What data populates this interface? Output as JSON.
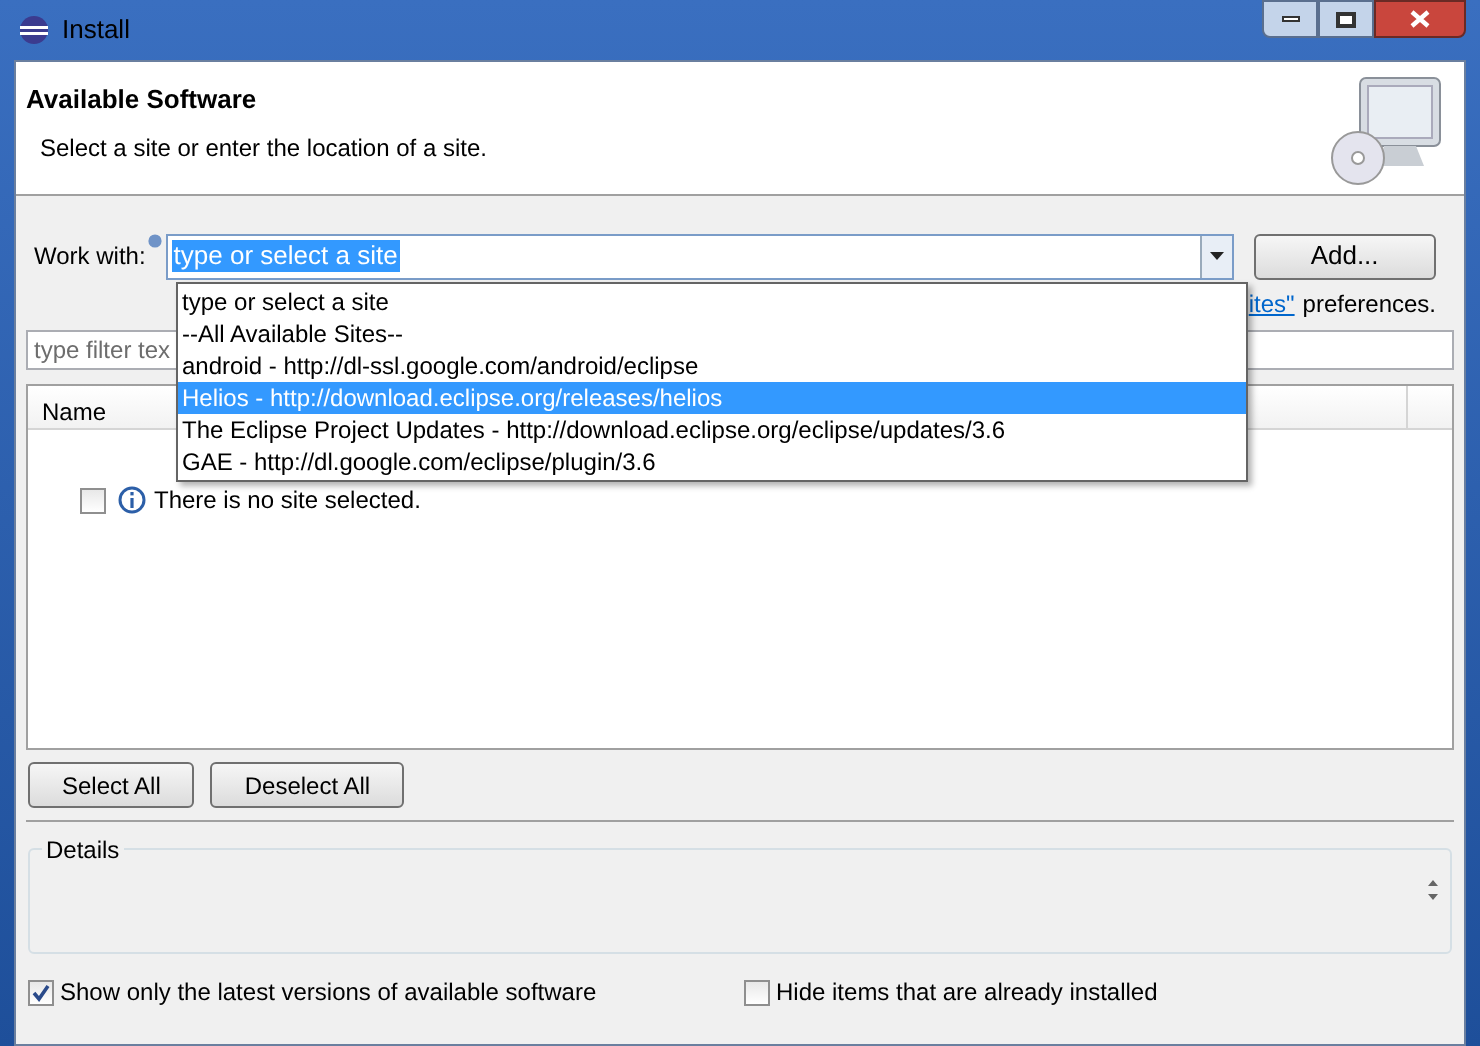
{
  "window": {
    "title": "Install"
  },
  "header": {
    "title": "Available Software",
    "subtitle": "Select a site or enter the location of a site."
  },
  "work_with": {
    "label": "Work with:",
    "value": "type or select a site",
    "button": "Add..."
  },
  "dropdown": [
    {
      "label": "type or select a site",
      "selected": false
    },
    {
      "label": "--All Available Sites--",
      "selected": false
    },
    {
      "label": "android - http://dl-ssl.google.com/android/eclipse",
      "selected": false
    },
    {
      "label": "Helios - http://download.eclipse.org/releases/helios",
      "selected": true
    },
    {
      "label": "The Eclipse Project Updates - http://download.eclipse.org/eclipse/updates/3.6",
      "selected": false
    },
    {
      "label": "GAE - http://dl.google.com/eclipse/plugin/3.6",
      "selected": false
    }
  ],
  "sites_link": {
    "link": "ites\"",
    "text": "preferences."
  },
  "filter": {
    "placeholder": "type filter tex"
  },
  "table": {
    "columns": [
      "Name"
    ],
    "rows": [
      {
        "checked": false,
        "text": "There is no site selected."
      }
    ]
  },
  "buttons": [
    "Select All",
    "Deselect All"
  ],
  "details": {
    "label": "Details"
  },
  "options": [
    {
      "label": "Show only the latest versions of available software",
      "checked": true
    },
    {
      "label": "Hide items that are already installed",
      "checked": false
    }
  ]
}
